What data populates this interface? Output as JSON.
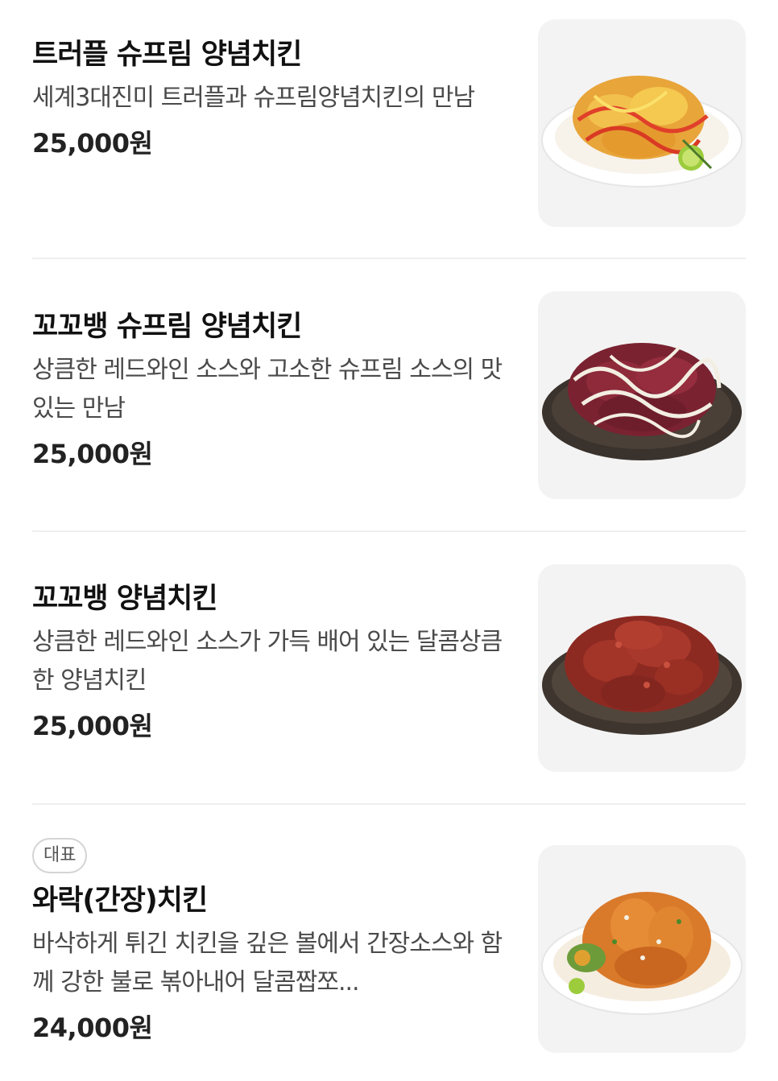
{
  "menu": {
    "items": [
      {
        "title": "트러플 슈프림 양념치킨",
        "description": "세계3대진미 트러플과 슈프림양념치킨의 만남",
        "price": "25,000원",
        "image": "truffle-supreme-chicken-photo"
      },
      {
        "title": "꼬꼬뱅 슈프림 양념치킨",
        "description": "상큼한 레드와인 소스와 고소한 슈프림 소스의 맛있는 만남",
        "price": "25,000원",
        "image": "coqauvin-supreme-chicken-photo"
      },
      {
        "title": "꼬꼬뱅 양념치킨",
        "description": "상큼한 레드와인 소스가 가득 배어 있는 달콤상큼한 양념치킨",
        "price": "25,000원",
        "image": "coqauvin-seasoned-chicken-photo"
      },
      {
        "badge": "대표",
        "title": "와락(간장)치킨",
        "description": "바삭하게 튀긴 치킨을 깊은 볼에서 간장소스와 함께 강한 불로 볶아내어 달콤짭쪼...",
        "price": "24,000원",
        "image": "warak-soy-chicken-photo"
      }
    ]
  },
  "colors": {
    "background": "#ffffff",
    "text_primary": "#111111",
    "text_secondary": "#4a4a4a",
    "thumb_bg": "#f3f3f3",
    "divider": "#efefef"
  }
}
